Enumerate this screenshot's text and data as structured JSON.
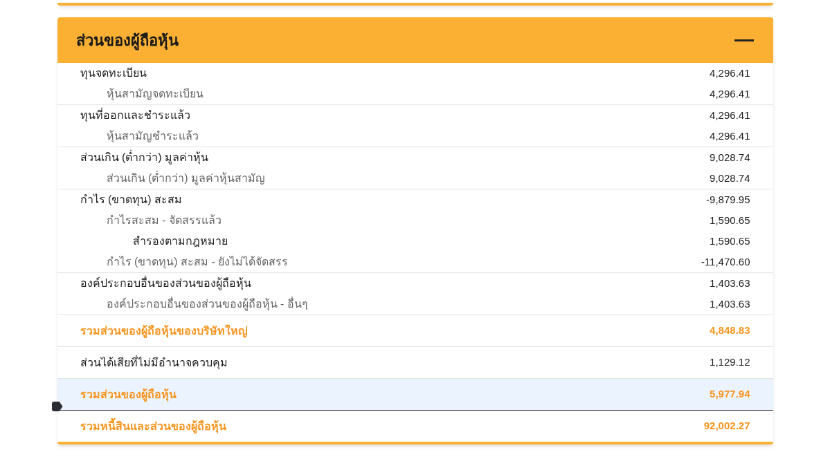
{
  "panel": {
    "title": "ส่วนของผู้ถือหุ้น",
    "expanded": true
  },
  "sections": [
    {
      "kind": "group",
      "selected": false,
      "label": "ทุนจดทะเบียน",
      "value": "4,296.41",
      "children": [
        {
          "label": "หุ้นสามัญจดทะเบียน",
          "value": "4,296.41"
        }
      ]
    },
    {
      "kind": "group",
      "selected": false,
      "label": "ทุนที่ออกและชำระแล้ว",
      "value": "4,296.41",
      "children": [
        {
          "label": "หุ้นสามัญชำระแล้ว",
          "value": "4,296.41"
        }
      ]
    },
    {
      "kind": "group",
      "selected": false,
      "label": "ส่วนเกิน (ต่ำกว่า) มูลค่าหุ้น",
      "value": "9,028.74",
      "children": [
        {
          "label": "ส่วนเกิน (ต่ำกว่า) มูลค่าหุ้นสามัญ",
          "value": "9,028.74"
        }
      ]
    },
    {
      "kind": "group",
      "selected": false,
      "label": "กำไร (ขาดทุน) สะสม",
      "value": "-9,879.95",
      "children": [
        {
          "label": "กำไรสะสม - จัดสรรแล้ว",
          "value": "1,590.65",
          "children": [
            {
              "label": "สำรองตามกฎหมาย",
              "value": "1,590.65"
            }
          ]
        },
        {
          "label": "กำไร (ขาดทุน) สะสม - ยังไม่ได้จัดสรร",
          "value": "-11,470.60"
        }
      ]
    },
    {
      "kind": "group",
      "selected": false,
      "label": "องค์ประกอบอื่นของส่วนของผู้ถือหุ้น",
      "value": "1,403.63",
      "children": [
        {
          "label": "องค์ประกอบอื่นของส่วนของผู้ถือหุ้น - อื่นๆ",
          "value": "1,403.63"
        }
      ]
    },
    {
      "kind": "total",
      "selected": false,
      "label": "รวมส่วนของผู้ถือหุ้นของบริษัทใหญ่",
      "value": "4,848.83"
    },
    {
      "kind": "plain",
      "selected": false,
      "label": "ส่วนได้เสียที่ไม่มีอำนาจควบคุม",
      "value": "1,129.12"
    },
    {
      "kind": "total",
      "selected": true,
      "label": "รวมส่วนของผู้ถือหุ้น",
      "value": "5,977.94"
    },
    {
      "kind": "total",
      "selected": false,
      "label": "รวมหนี้สินและส่วนของผู้ถือหุ้น",
      "value": "92,002.27"
    }
  ]
}
